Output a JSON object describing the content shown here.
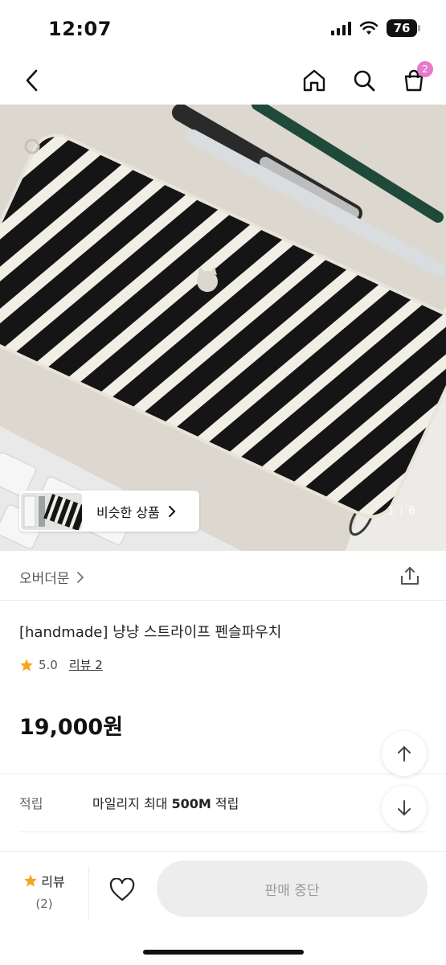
{
  "status_bar": {
    "time": "12:07",
    "battery": "76"
  },
  "nav": {
    "cart_count": "2"
  },
  "gallery": {
    "similar_label": "비슷한 상품",
    "current": "1",
    "total": "6"
  },
  "seller": {
    "name": "오버더문"
  },
  "product": {
    "title": "[handmade] 냥냥 스트라이프 펜슬파우치",
    "rating": "5.0",
    "review_link": "리뷰 2",
    "price": "19,000원"
  },
  "points": {
    "label": "적립",
    "prefix": "마일리지 최대 ",
    "amount": "500M",
    "suffix": " 적립"
  },
  "bottom_bar": {
    "review_label": "리뷰",
    "review_count": "(2)",
    "sold_label": "판매 중단"
  },
  "colors": {
    "star": "#f5a623",
    "badge": "#e879c9",
    "disabled_button": "#ededed"
  },
  "icons": [
    "back-icon",
    "home-icon",
    "search-icon",
    "cart-icon",
    "chevron-right-icon",
    "share-icon",
    "star-icon",
    "arrow-up-icon",
    "arrow-down-icon",
    "heart-icon"
  ]
}
